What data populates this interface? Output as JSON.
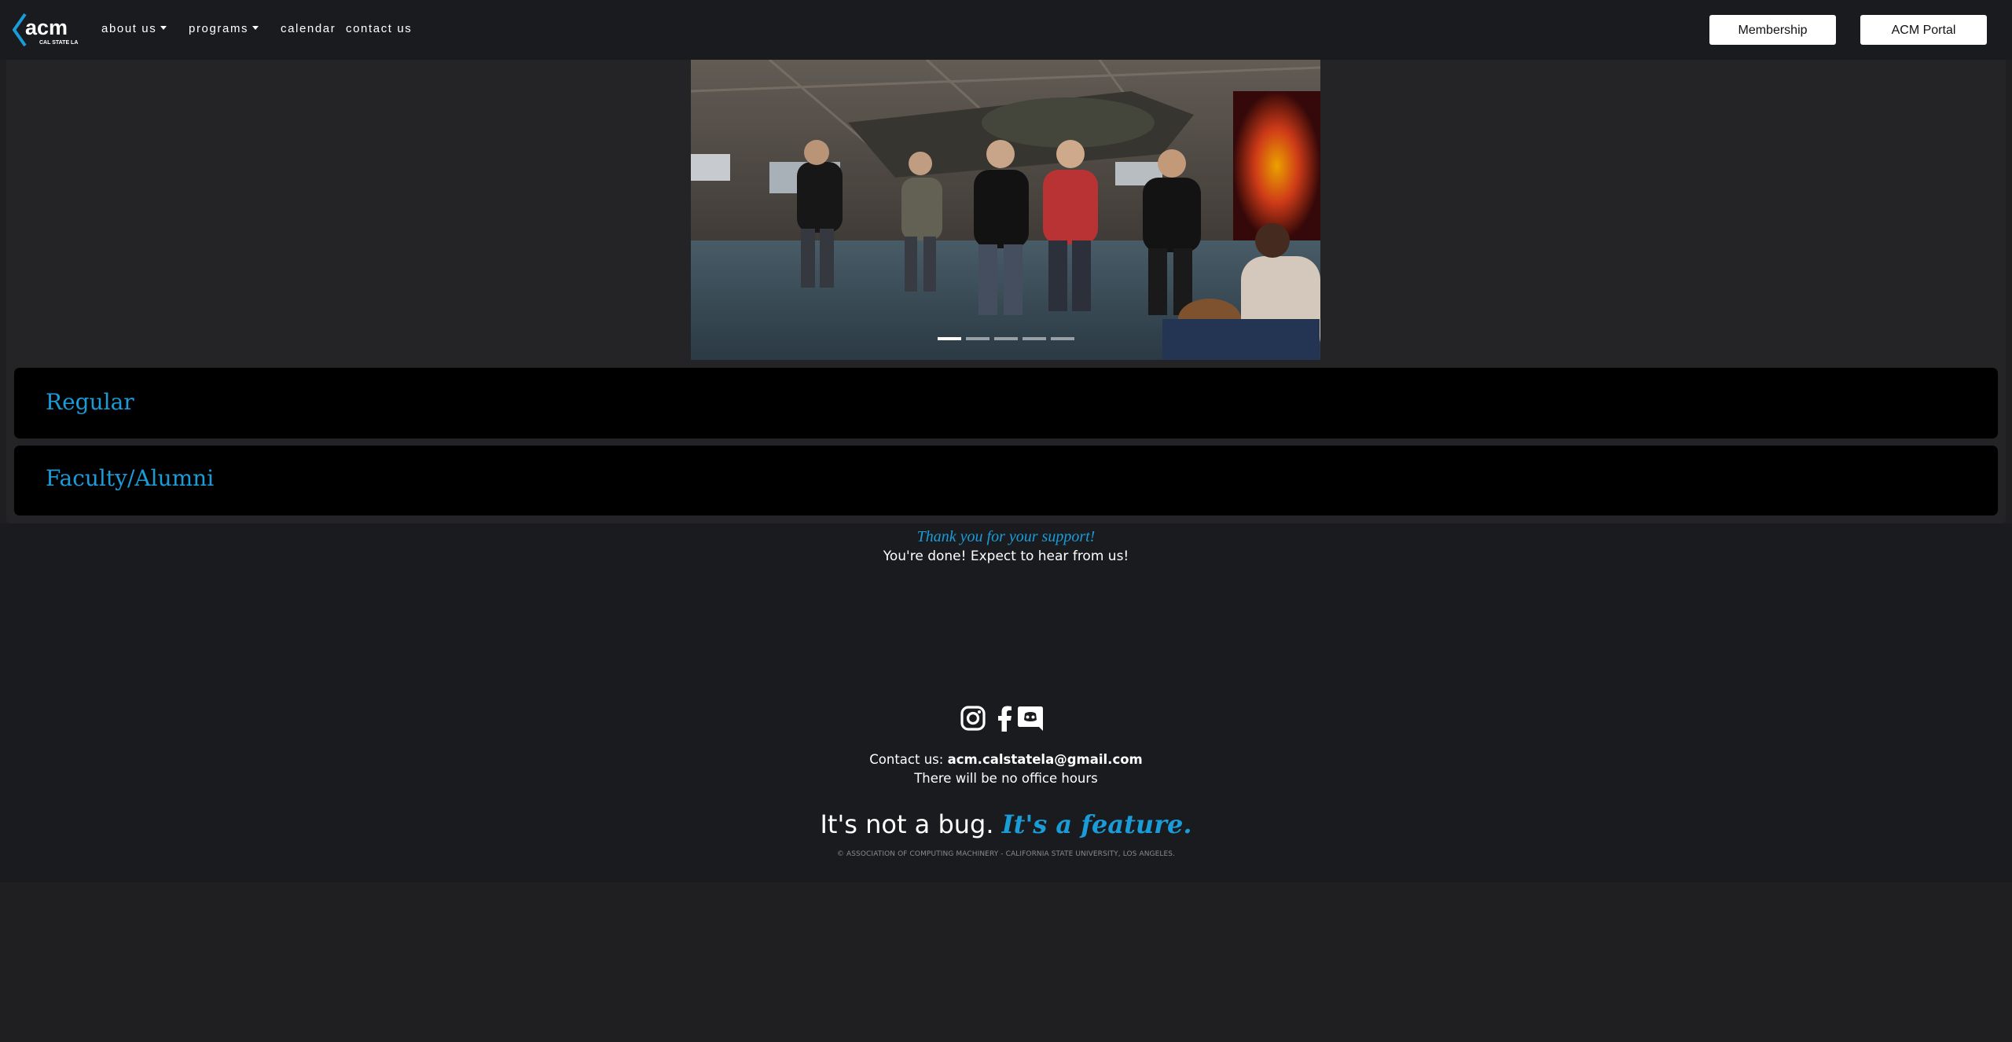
{
  "nav": {
    "logo_text": "acm",
    "logo_sub": "CAL STATE LA",
    "items": [
      {
        "label": "about us",
        "dropdown": true
      },
      {
        "label": "programs",
        "dropdown": true
      },
      {
        "label": "calendar",
        "dropdown": false
      },
      {
        "label": "contact us",
        "dropdown": false
      }
    ],
    "buttons": {
      "membership": "Membership",
      "portal": "ACM Portal"
    }
  },
  "carousel": {
    "slide_count": 5,
    "active_index": 0
  },
  "cards": [
    {
      "title": "Regular"
    },
    {
      "title": "Faculty/Alumni"
    }
  ],
  "confirmation": {
    "thanks": "Thank you for your support!",
    "done": "You're done! Expect to hear from us!"
  },
  "footer": {
    "social_icons": [
      "instagram-icon",
      "facebook-icon",
      "discord-icon"
    ],
    "contact_prefix": "Contact us: ",
    "contact_email": "acm.calstatela@gmail.com",
    "office_hours": "There will be no office hours",
    "tagline_plain": "It's not a bug. ",
    "tagline_emph": "It's a feature.",
    "copyright": "© ASSOCIATION OF COMPUTING MACHINERY - CALIFORNIA STATE UNIVERSITY, LOS ANGELES."
  },
  "colors": {
    "accent": "#1a9cd8",
    "navbar_bg": "#1a1b1e",
    "page_bg": "#1f1f21",
    "card_bg": "#000000"
  }
}
